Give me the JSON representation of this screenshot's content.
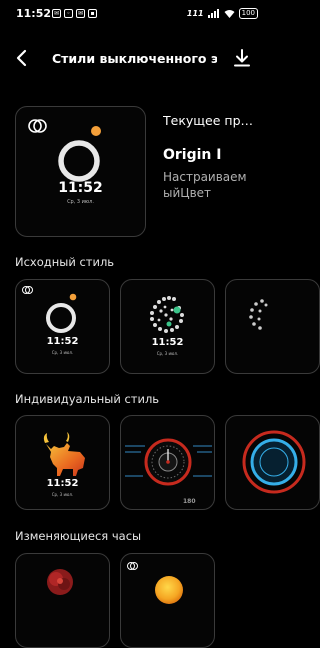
{
  "status_bar": {
    "time": "11:52",
    "left_icons": [
      "message-icon",
      "chat-icon",
      "mail-icon",
      "sim-icon"
    ],
    "right_icons": [
      "cellular-signal-icon",
      "wifi-icon",
      "battery-icon"
    ],
    "network_label": "111",
    "battery": "100"
  },
  "header": {
    "title": "Стили выключенного эк…"
  },
  "current": {
    "heading": "Текущее пр…",
    "name": "Origin I",
    "customize": "Настраиваем ыйЦвет",
    "preview_time": "11:52",
    "preview_date": "Ср, 3 июл."
  },
  "sections": [
    {
      "title": "Исходный стиль"
    },
    {
      "title": "Индивидуальный стиль"
    },
    {
      "title": "Изменяющиеся часы"
    }
  ],
  "previews": {
    "origin_time": "11:52",
    "origin_date": "Ср, 3 июл.",
    "dots_time": "11:52",
    "dots_date": "Ср, 3 июл.",
    "bull_time": "11:52",
    "bull_date": "Ср, 3 июл.",
    "dash_value": "180"
  },
  "colors": {
    "accent_orange": "#f4a03a",
    "ring": "#e8e8e8",
    "dial_red": "#c62a1e",
    "dial_blue": "#35aee8"
  }
}
